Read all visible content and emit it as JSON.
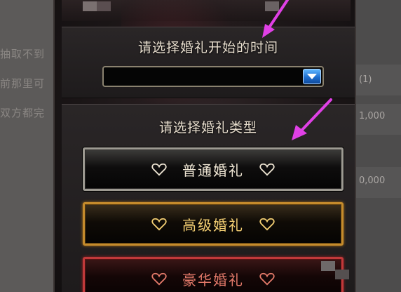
{
  "background_page": {
    "left_lines": [
      "抽取不到",
      "前那里可",
      "双方都完"
    ],
    "right_values": [
      "(1)",
      "1,000",
      "0,000"
    ]
  },
  "dialog": {
    "time_heading": "请选择婚礼开始的时间",
    "time_select": {
      "value": "",
      "icon": "chevron-down-icon"
    },
    "type_heading": "请选择婚礼类型",
    "wedding_types": [
      {
        "label": "普通婚礼",
        "icon": "heart-outline-icon",
        "color": "#efe6d4"
      },
      {
        "label": "高级婚礼",
        "icon": "heart-outline-icon",
        "color": "#f4cf73"
      },
      {
        "label": "豪华婚礼",
        "icon": "heart-outline-icon",
        "color": "#e47a6a"
      }
    ]
  },
  "annotations": {
    "arrow_color": "#e040e6"
  }
}
